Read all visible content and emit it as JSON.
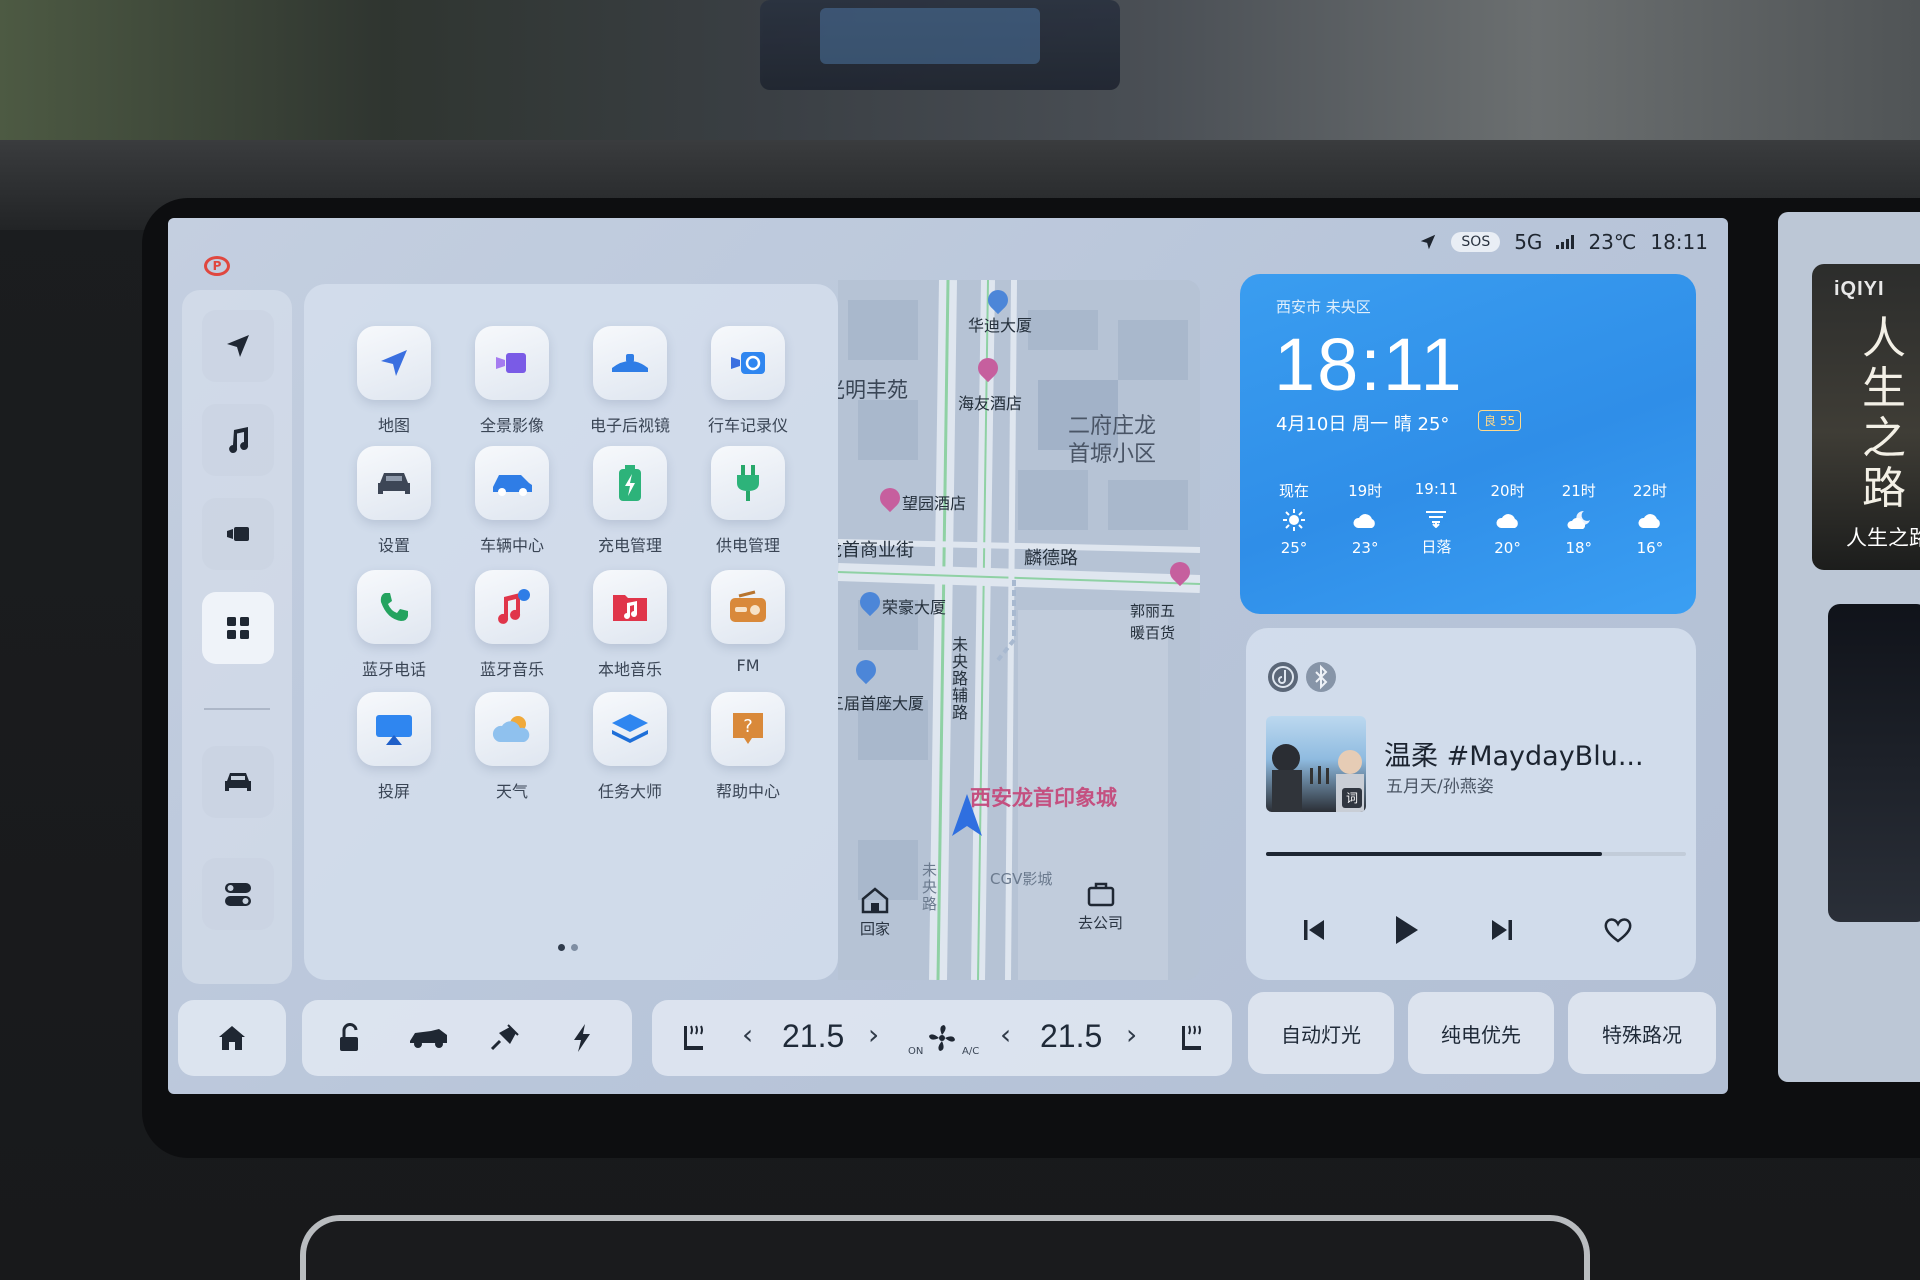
{
  "status": {
    "sos": "SOS",
    "network": "5G",
    "temperature": "23℃",
    "time": "18:11"
  },
  "apps": [
    {
      "label": "地图",
      "icon": "navigation-arrow-icon"
    },
    {
      "label": "全景影像",
      "icon": "panorama-camera-icon"
    },
    {
      "label": "电子后视镜",
      "icon": "rear-mirror-icon"
    },
    {
      "label": "行车记录仪",
      "icon": "dashcam-icon"
    },
    {
      "label": "设置",
      "icon": "car-settings-icon"
    },
    {
      "label": "车辆中心",
      "icon": "vehicle-center-icon"
    },
    {
      "label": "充电管理",
      "icon": "battery-charge-icon"
    },
    {
      "label": "供电管理",
      "icon": "power-plug-icon"
    },
    {
      "label": "蓝牙电话",
      "icon": "phone-icon"
    },
    {
      "label": "蓝牙音乐",
      "icon": "bluetooth-music-icon"
    },
    {
      "label": "本地音乐",
      "icon": "local-music-icon"
    },
    {
      "label": "FM",
      "icon": "radio-icon"
    },
    {
      "label": "投屏",
      "icon": "screen-cast-icon"
    },
    {
      "label": "天气",
      "icon": "weather-cloud-icon"
    },
    {
      "label": "任务大师",
      "icon": "task-layers-icon"
    },
    {
      "label": "帮助中心",
      "icon": "help-icon"
    }
  ],
  "map": {
    "labels": {
      "huadi": "华迪大厦",
      "haiyou": "海友酒店",
      "mingfeng": "光明丰苑",
      "erfu": "二府庄龙",
      "shouyuan": "首塬小区",
      "wangyuan": "望园酒店",
      "shoushang": "龙首商业街",
      "linde": "麟德路",
      "ronghao": "荣豪大厦",
      "guoli": "郭丽五",
      "nuanbai": "暖百货",
      "weiyang_fu": "未央路辅路",
      "jieshouzuo": "三届首座大厦",
      "longshou": "西安龙首印象城",
      "weiyang": "未央路",
      "cgv": "CGV影城"
    },
    "home_label": "回家",
    "company_label": "去公司"
  },
  "weather": {
    "location": "西安市 未央区",
    "time": "18:11",
    "date_line": "4月10日 周一  晴  25°",
    "aqi": "良 55",
    "hourly": [
      {
        "time": "现在",
        "icon": "sun-icon",
        "temp": "25°"
      },
      {
        "time": "19时",
        "icon": "cloud-icon",
        "temp": "23°"
      },
      {
        "time": "19:11",
        "icon": "sunset-icon",
        "temp": "日落"
      },
      {
        "time": "20时",
        "icon": "cloud-icon",
        "temp": "20°"
      },
      {
        "time": "21时",
        "icon": "moon-cloud-icon",
        "temp": "18°"
      },
      {
        "time": "22时",
        "icon": "cloud-icon",
        "temp": "16°"
      }
    ]
  },
  "music": {
    "title": "温柔 #MaydayBlu...",
    "artist": "五月天/孙燕姿",
    "lyric_tag": "词",
    "progress": 0.8
  },
  "climate": {
    "left_temp": "21.5",
    "right_temp": "21.5",
    "fan_on": "ON",
    "ac": "A/C"
  },
  "quick_actions": {
    "auto_light": "自动灯光",
    "ev_priority": "纯电优先",
    "special_road": "特殊路况"
  },
  "side_screen": {
    "brand": "iQIYI",
    "poster_caption": "人生之路",
    "poster_art": "人生之路"
  },
  "colors": {
    "weather_card": "#2f8ee8",
    "parking_indicator": "#e0473f",
    "map_poi_pink": "#c45080"
  }
}
